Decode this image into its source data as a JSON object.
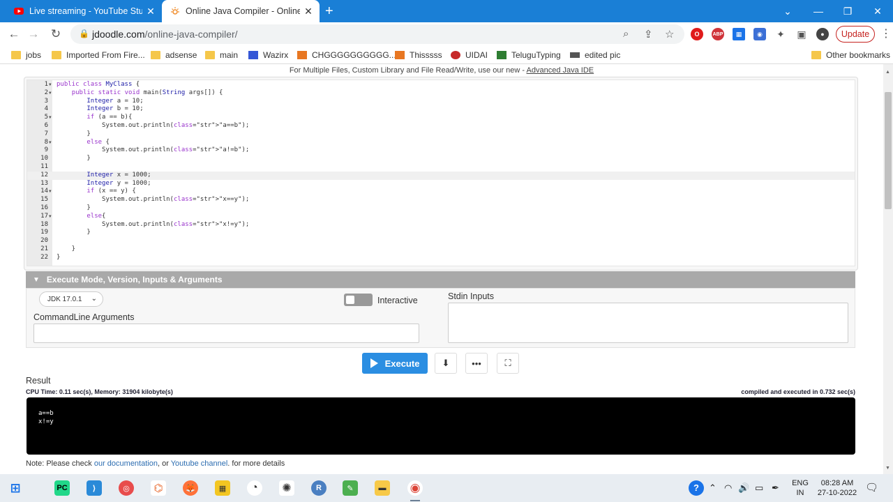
{
  "browser": {
    "tabs": [
      {
        "title": "Live streaming - YouTube Studio",
        "active": false
      },
      {
        "title": "Online Java Compiler - Online Java",
        "active": true
      }
    ],
    "url_host": "jdoodle.com",
    "url_path": "/online-java-compiler/",
    "update_label": "Update",
    "bookmarks": [
      "jobs",
      "Imported From Fire...",
      "adsense",
      "main",
      "Wazirx",
      "CHGGGGGGGGGG...",
      "Thisssss",
      "UIDAI",
      "TeluguTyping",
      "edited pic"
    ],
    "other_bookmarks": "Other bookmarks",
    "accent": "#1a7fd6"
  },
  "page": {
    "notice_text": "For Multiple Files, Custom Library and File Read/Write, use our new - ",
    "notice_link": "Advanced Java IDE",
    "code_lines": [
      "public class MyClass {",
      "    public static void main(String args[]) {",
      "        Integer a = 10;",
      "        Integer b = 10;",
      "        if (a == b){",
      "            System.out.println(\"a==b\");",
      "        }",
      "        else {",
      "            System.out.println(\"a!=b\");",
      "        }",
      "",
      "        Integer x = 1000;",
      "        Integer y = 1000;",
      "        if (x == y) {",
      "            System.out.println(\"x==y\");",
      "        }",
      "        else{",
      "            System.out.println(\"x!=y\");",
      "        }",
      "",
      "    }",
      "}"
    ],
    "execute_header": "Execute Mode, Version, Inputs & Arguments",
    "jdk_version": "JDK 17.0.1",
    "interactive_label": "Interactive",
    "stdin_label": "Stdin Inputs",
    "cmdline_label": "CommandLine Arguments",
    "execute_label": "Execute",
    "result_label": "Result",
    "cpu_info": "CPU Time: 0.11 sec(s), Memory: 31904 kilobyte(s)",
    "compiled_info": "compiled and executed in 0.732 sec(s)",
    "output_text": "a==b\nx!=y",
    "footnote_pre": "Note: Please check ",
    "footnote_doc": "our documentation",
    "footnote_mid": ", or ",
    "footnote_yt": "Youtube channel",
    "footnote_post": ". for more details"
  },
  "taskbar": {
    "lang1": "ENG",
    "lang2": "IN",
    "time": "08:28 AM",
    "date": "27-10-2022"
  }
}
